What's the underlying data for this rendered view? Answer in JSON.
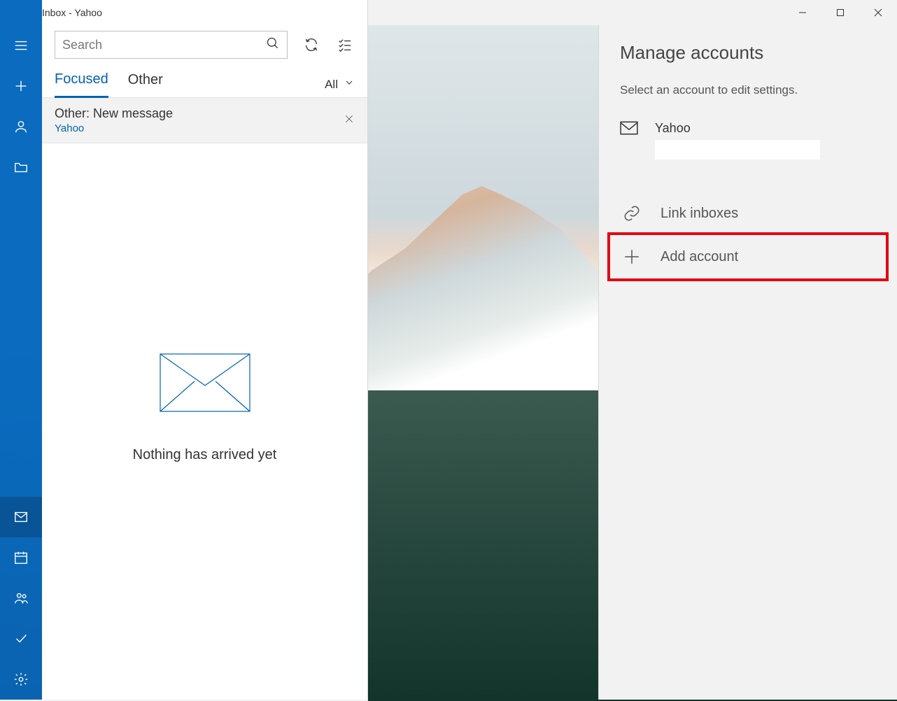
{
  "window": {
    "title": "Inbox - Yahoo"
  },
  "search": {
    "placeholder": "Search"
  },
  "tabs": {
    "focused": "Focused",
    "other": "Other",
    "filter": "All"
  },
  "notification": {
    "title": "Other: New message",
    "source": "Yahoo"
  },
  "empty": {
    "message": "Nothing has arrived yet"
  },
  "panel": {
    "title": "Manage accounts",
    "subtitle": "Select an account to edit settings.",
    "account_name": "Yahoo",
    "link_label": "Link inboxes",
    "add_label": "Add account"
  }
}
